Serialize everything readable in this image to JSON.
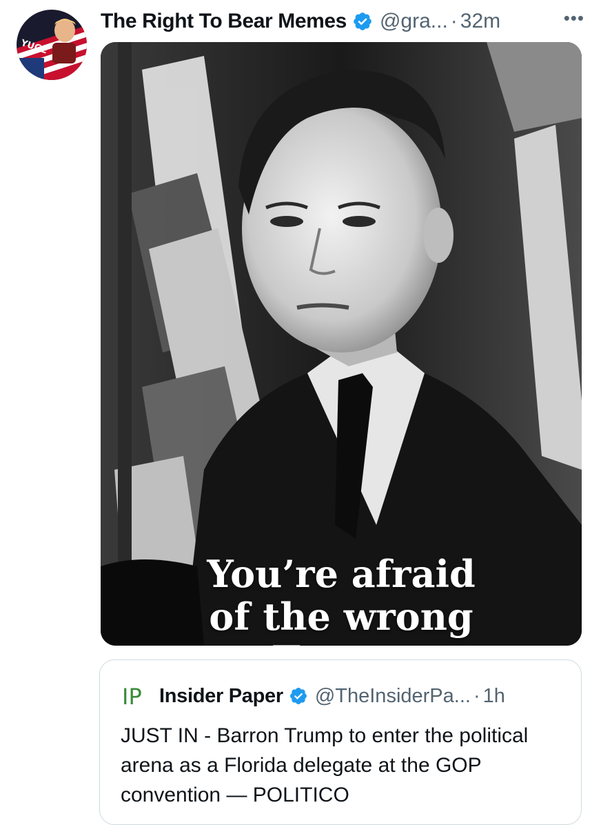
{
  "tweet": {
    "display_name": "The Right To Bear Memes",
    "handle": "@gra...",
    "separator": "·",
    "time": "32m",
    "more_icon": "more-horizontal-icon",
    "avatar_text": "YUGE",
    "verified_icon": "verified-badge-icon",
    "media": {
      "caption_lines": [
        "You’re afraid",
        "of the wrong",
        "Trump"
      ]
    }
  },
  "quoted_tweet": {
    "logo_text": "IP",
    "display_name": "Insider Paper",
    "handle": "@TheInsiderPa...",
    "separator": "·",
    "time": "1h",
    "text": "JUST IN - Barron Trump to enter the political arena as a Florida delegate at the GOP convention  — POLITICO"
  },
  "colors": {
    "verified": "#1d9bf0",
    "secondary_text": "#536471",
    "border": "#cfd9de",
    "logo_green": "#3a8c3a"
  }
}
